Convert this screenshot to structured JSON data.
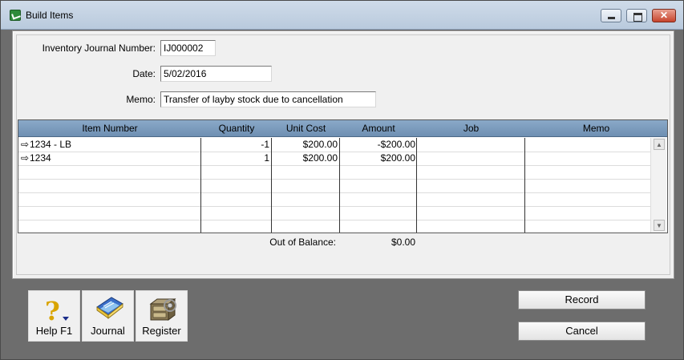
{
  "window": {
    "title": "Build Items"
  },
  "form": {
    "journal_number_label": "Inventory Journal Number:",
    "journal_number_value": "IJ000002",
    "date_label": "Date:",
    "date_value": "5/02/2016",
    "memo_label": "Memo:",
    "memo_value": "Transfer of layby stock due to cancellation"
  },
  "grid": {
    "columns": [
      "Item Number",
      "Quantity",
      "Unit Cost",
      "Amount",
      "Job",
      "Memo"
    ],
    "rows": [
      {
        "item_number": "1234 - LB",
        "quantity": "-1",
        "unit_cost": "$200.00",
        "amount": "-$200.00",
        "job": "",
        "memo": ""
      },
      {
        "item_number": "1234",
        "quantity": "1",
        "unit_cost": "$200.00",
        "amount": "$200.00",
        "job": "",
        "memo": ""
      }
    ]
  },
  "balance": {
    "label": "Out of Balance:",
    "value": "$0.00"
  },
  "toolbar": {
    "help_label": "Help F1",
    "journal_label": "Journal",
    "register_label": "Register"
  },
  "buttons": {
    "record_label": "Record",
    "cancel_label": "Cancel"
  },
  "colors": {
    "header_blue": "#7c9cbf",
    "background_gray": "#6d6d6d",
    "panel": "#f0f0f0"
  }
}
